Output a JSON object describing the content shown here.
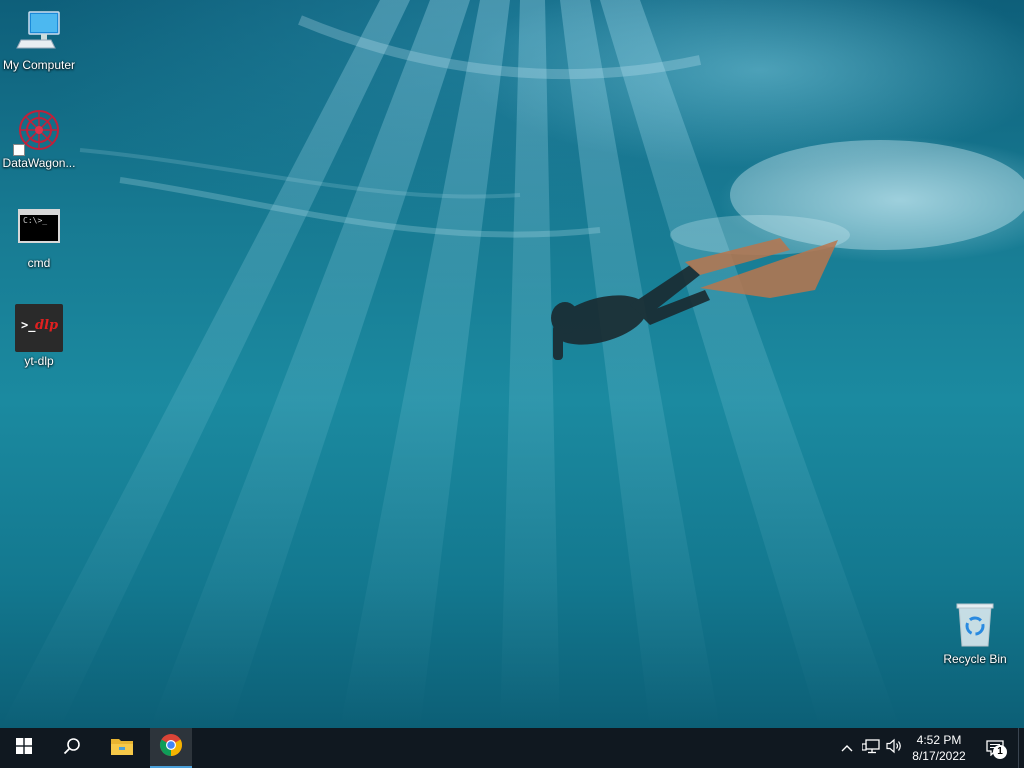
{
  "desktop": {
    "icons": [
      {
        "label": "My Computer",
        "icon": "computer-icon"
      },
      {
        "label": "DataWagon...",
        "icon": "datawagon-icon"
      },
      {
        "label": "cmd",
        "icon": "cmd-icon"
      },
      {
        "label": "yt-dlp",
        "icon": "yt-dlp-icon",
        "glyph_text": ">_",
        "glyph_accent": "dlp"
      },
      {
        "label": "Recycle Bin",
        "icon": "recycle-bin-icon"
      }
    ],
    "cmd_glyph_text": "C:\\>_"
  },
  "taskbar": {
    "start": "windows-start-icon",
    "search": "search-icon",
    "pinned": [
      {
        "name": "file-explorer",
        "icon": "folder-icon"
      },
      {
        "name": "chrome",
        "icon": "chrome-icon",
        "active": true
      }
    ],
    "tray": {
      "icons": [
        "chevron-up-icon",
        "network-icon",
        "volume-icon"
      ],
      "time": "4:52 PM",
      "date": "8/17/2022",
      "notifications_count": "1"
    }
  },
  "colors": {
    "taskbar": "#101820",
    "accent": "#4a9fd8",
    "water_dark": "#0e5f7a",
    "water_light": "#1b8aa0"
  }
}
